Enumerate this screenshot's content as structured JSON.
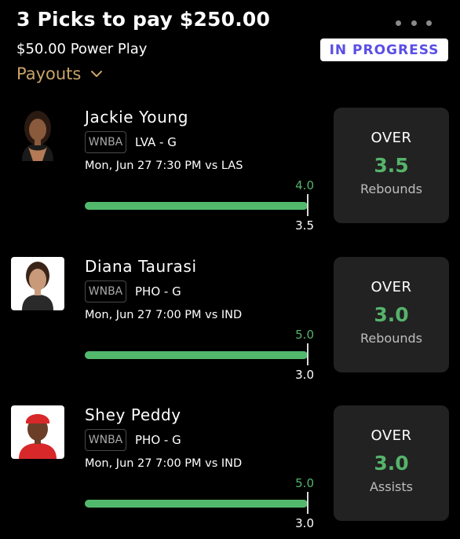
{
  "header": {
    "title": "3 Picks to pay $250.00",
    "subtitle": "$50.00 Power Play",
    "status": "IN PROGRESS",
    "payouts_label": "Payouts",
    "more_icon": "more-horizontal-icon",
    "chevron_icon": "chevron-down-icon"
  },
  "colors": {
    "background": "#000000",
    "card": "#222222",
    "accent_green": "#56b36b",
    "accent_gold": "#c9a46a",
    "status_text": "#5a4ee6"
  },
  "picks": [
    {
      "name": "Jackie Young",
      "league": "WNBA",
      "team_pos": "LVA - G",
      "game": "Mon, Jun 27 7:30 PM  vs LAS",
      "current": "4.0",
      "line": "3.5",
      "direction": "OVER",
      "stat": "Rebounds",
      "progress": 1.0
    },
    {
      "name": "Diana Taurasi",
      "league": "WNBA",
      "team_pos": "PHO - G",
      "game": "Mon, Jun 27 7:00 PM  vs IND",
      "current": "5.0",
      "line": "3.0",
      "direction": "OVER",
      "stat": "Rebounds",
      "progress": 1.0
    },
    {
      "name": "Shey Peddy",
      "league": "WNBA",
      "team_pos": "PHO - G",
      "game": "Mon, Jun 27 7:00 PM  vs IND",
      "current": "5.0",
      "line": "3.0",
      "direction": "OVER",
      "stat": "Assists",
      "progress": 1.0
    }
  ]
}
